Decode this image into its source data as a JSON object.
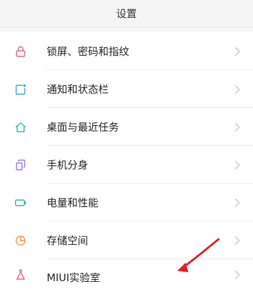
{
  "header": {
    "title": "设置"
  },
  "items": [
    {
      "label": "锁屏、密码和指纹",
      "icon": "lock-icon",
      "color": "#e0637e"
    },
    {
      "label": "通知和状态栏",
      "icon": "notification-icon",
      "color": "#3aa6d8"
    },
    {
      "label": "桌面与最近任务",
      "icon": "home-icon",
      "color": "#2cb7a4"
    },
    {
      "label": "手机分身",
      "icon": "dual-phone-icon",
      "color": "#9a7ad6"
    },
    {
      "label": "电量和性能",
      "icon": "battery-icon",
      "color": "#2ab58f"
    },
    {
      "label": "存储空间",
      "icon": "storage-pie-icon",
      "color": "#f0954a"
    },
    {
      "label": "MIUI实验室",
      "icon": "lab-flask-icon",
      "color": "#e0637e"
    }
  ],
  "annotation": {
    "color": "#e02020"
  }
}
